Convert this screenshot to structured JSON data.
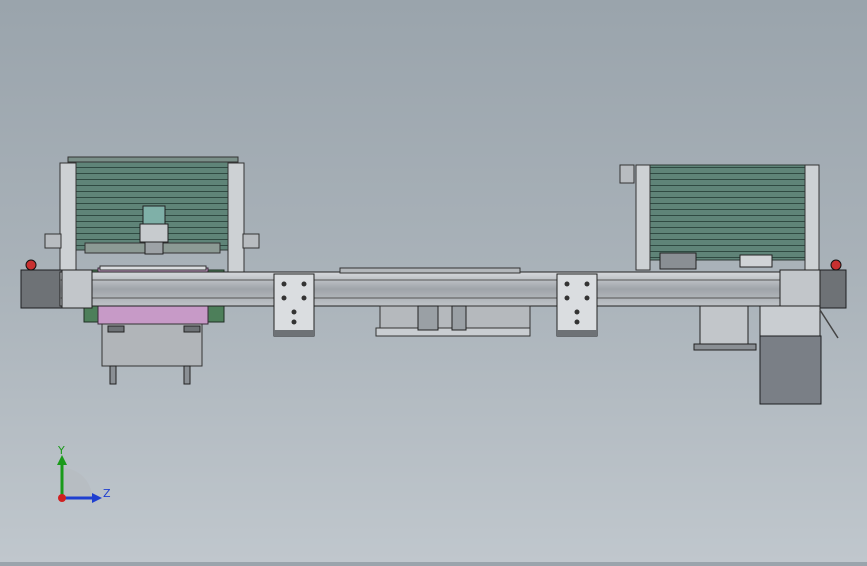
{
  "colors": {
    "teal_slats": "#5f8478",
    "slat_line": "#2f4a42",
    "frame_grey": "#c9cdd1",
    "rail_grey": "#a3a8ad",
    "dark_end": "#6e7276",
    "pink_plate": "#c79ac7",
    "green_base": "#4d7f5a",
    "motor_dark": "#7a7f86",
    "red_stop": "#c83030",
    "axis_y": "#1a9a1a",
    "axis_z": "#1f3fd0",
    "axis_origin": "#d02020"
  },
  "triad": {
    "y_label": "Y",
    "z_label": "Z"
  }
}
